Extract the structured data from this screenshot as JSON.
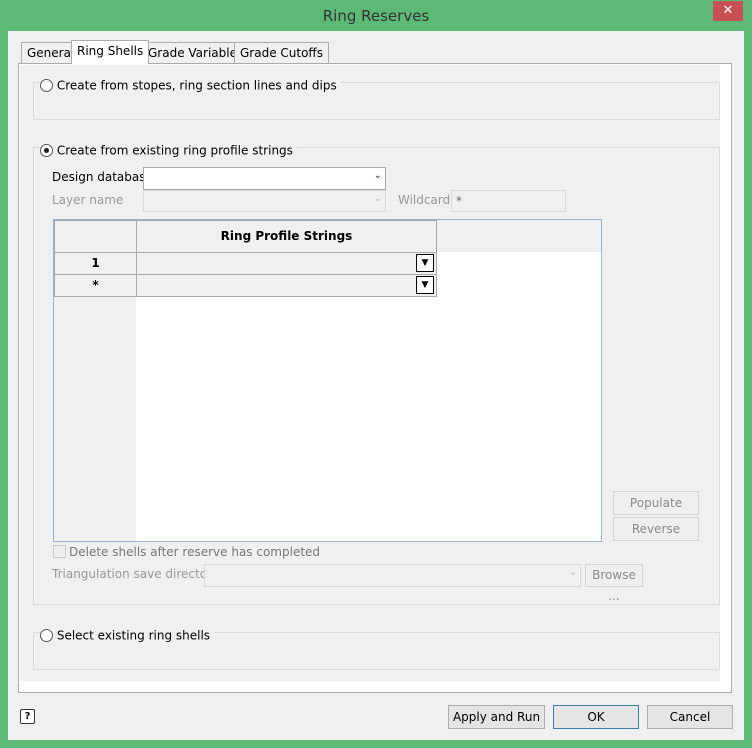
{
  "window": {
    "title": "Ring Reserves",
    "close_label": "✕"
  },
  "tabs": [
    {
      "label": "General"
    },
    {
      "label": "Ring Shells"
    },
    {
      "label": "Grade Variables"
    },
    {
      "label": "Grade Cutoffs"
    }
  ],
  "options": {
    "stopes": "Create from stopes, ring section lines and dips",
    "existing": "Create from existing ring profile strings",
    "select": "Select existing ring shells"
  },
  "form": {
    "design_database_label": "Design database",
    "design_database_value": "",
    "layer_name_label": "Layer name",
    "wildcard_label": "Wildcard",
    "wildcard_value": "*"
  },
  "grid": {
    "column_header": "Ring Profile Strings",
    "rows": [
      {
        "id": "1",
        "value": ""
      },
      {
        "id": "*",
        "value": ""
      }
    ]
  },
  "side_buttons": {
    "populate": "Populate",
    "reverse": "Reverse"
  },
  "delete_shells_label": "Delete shells after reserve has completed",
  "triangulation": {
    "label": "Triangulation save directory",
    "browse": "Browse ..."
  },
  "footer": {
    "help": "?",
    "apply_run": "Apply and Run",
    "ok": "OK",
    "cancel": "Cancel"
  }
}
